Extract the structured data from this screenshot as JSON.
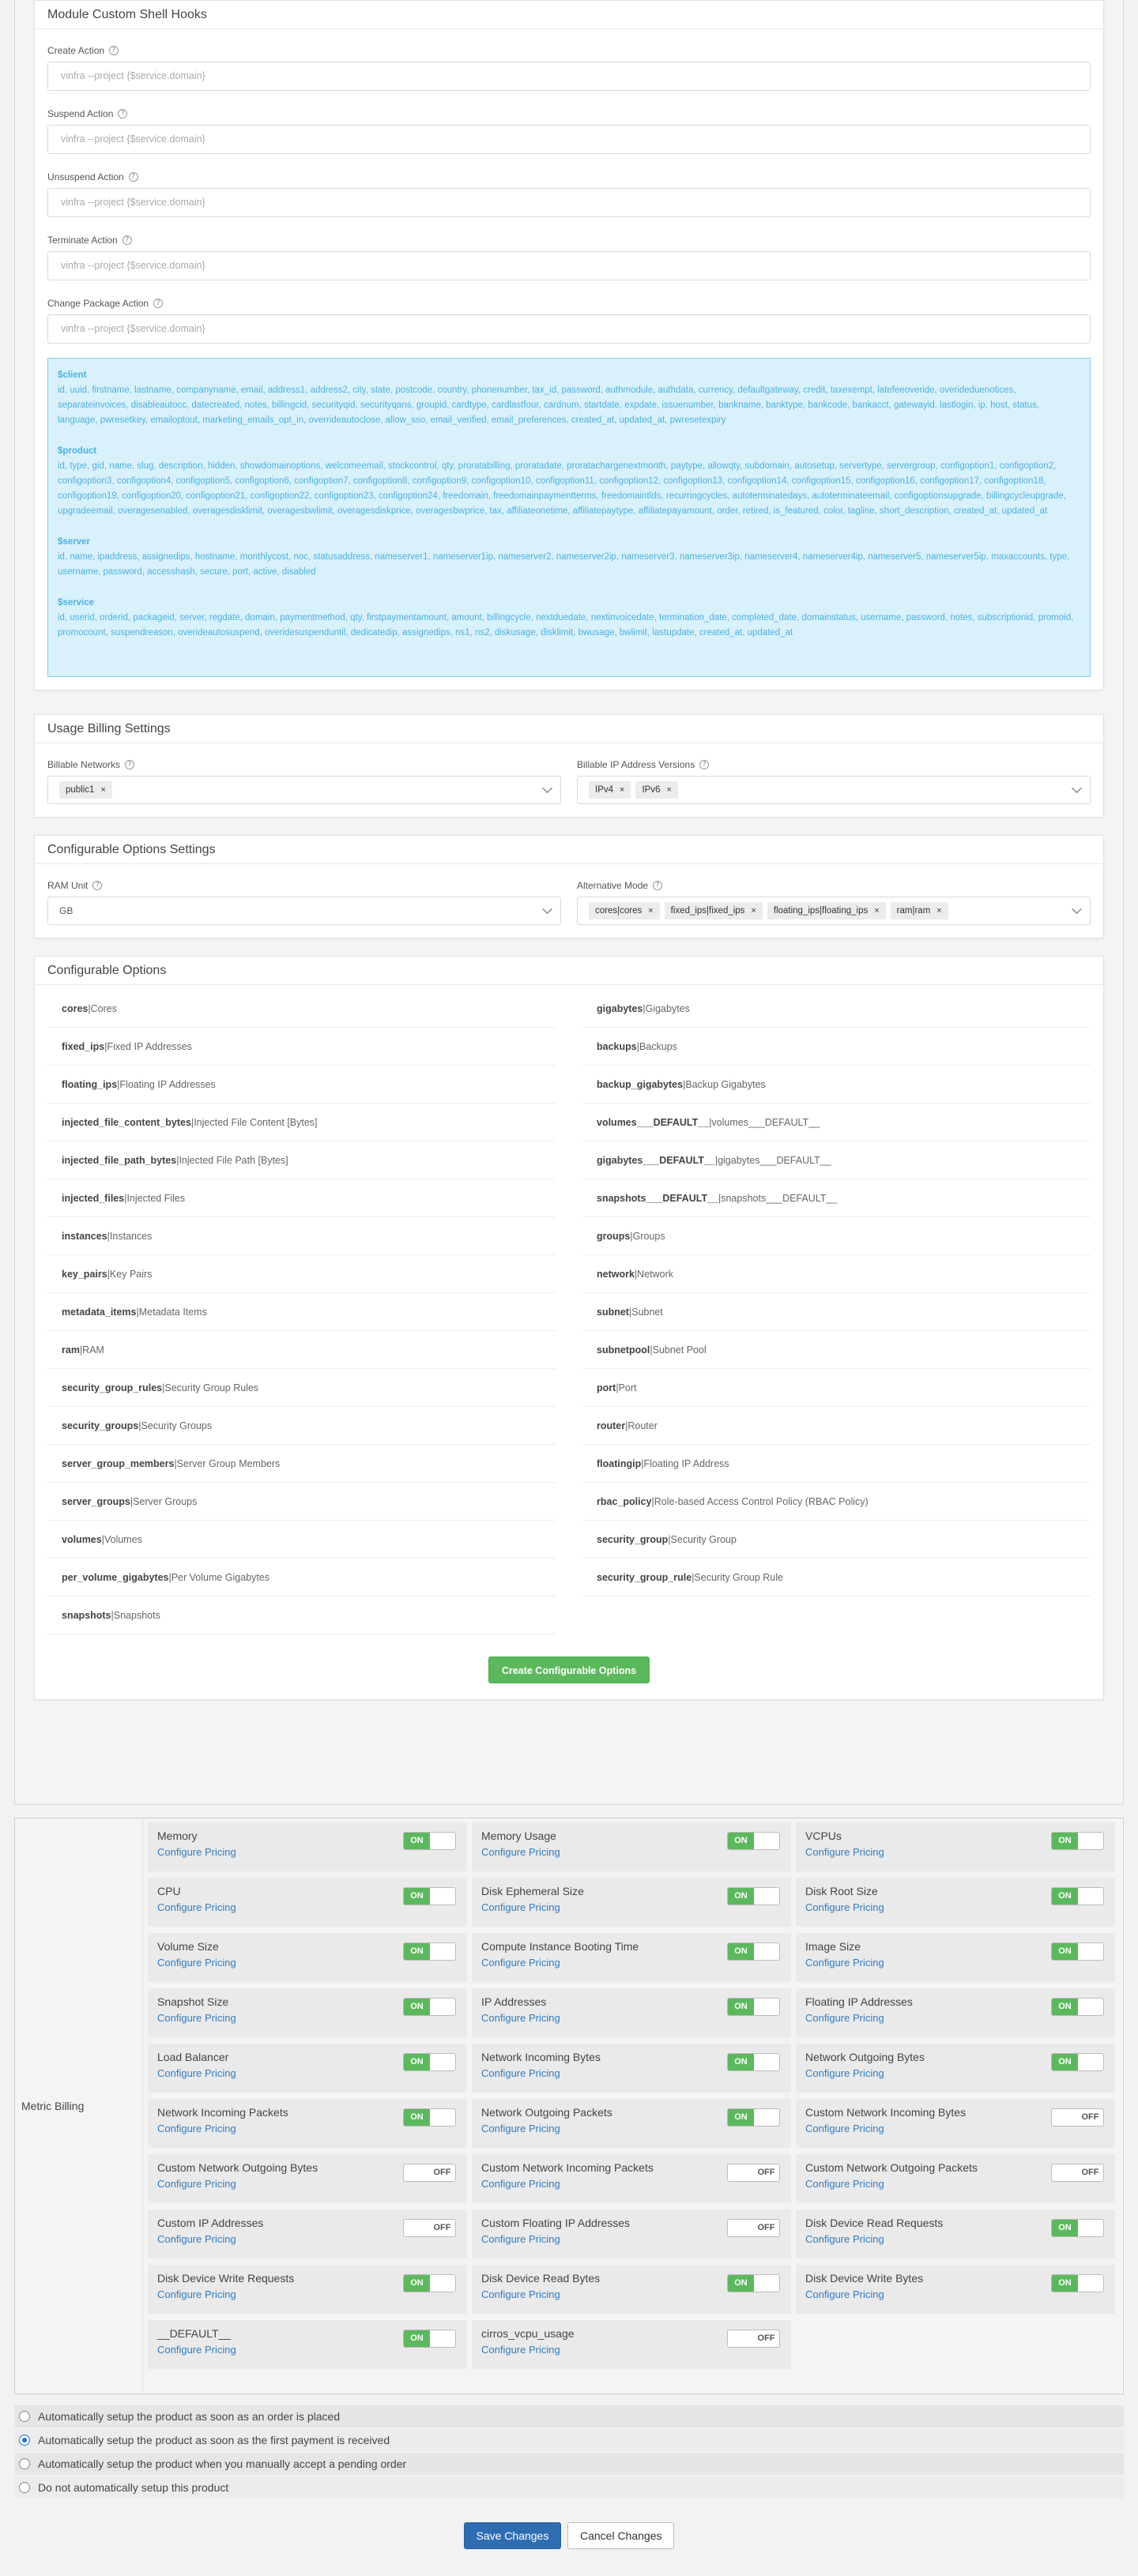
{
  "shell": {
    "title": "Module Custom Shell Hooks",
    "fields": [
      {
        "label": "Create Action",
        "placeholder": "vinfra --project {$service.domain}"
      },
      {
        "label": "Suspend Action",
        "placeholder": "vinfra --project {$service.domain}"
      },
      {
        "label": "Unsuspend Action",
        "placeholder": "vinfra --project {$service.domain}"
      },
      {
        "label": "Terminate Action",
        "placeholder": "vinfra --project {$service.domain}"
      },
      {
        "label": "Change Package Action",
        "placeholder": "vinfra --project {$service.domain}"
      }
    ],
    "variables": [
      {
        "title": "$client",
        "text": "id, uuid, firstname, lastname, companyname, email, address1, address2, city, state, postcode, country, phonenumber, tax_id, password, authmodule, authdata, currency, defaultgateway, credit, taxexempt, latefeeoveride, overideduenotices, separateinvoices, disableautocc, datecreated, notes, billingcid, securityqid, securityqans, groupid, cardtype, cardlastfour, cardnum, startdate, expdate, issuenumber, bankname, banktype, bankcode, bankacct, gatewayid, lastlogin, ip, host, status, language, pwresetkey, emailoptout, marketing_emails_opt_in, overrideautoclose, allow_sso, email_verified, email_preferences, created_at, updated_at, pwresetexpiry"
      },
      {
        "title": "$product",
        "text": "id, type, gid, name, slug, description, hidden, showdomainoptions, welcomeemail, stockcontrol, qty, proratabilling, proratadate, proratachargenextmonth, paytype, allowqty, subdomain, autosetup, servertype, servergroup, configoption1, configoption2, configoption3, configoption4, configoption5, configoption6, configoption7, configoption8, configoption9, configoption10, configoption11, configoption12, configoption13, configoption14, configoption15, configoption16, configoption17, configoption18, configoption19, configoption20, configoption21, configoption22, configoption23, configoption24, freedomain, freedomainpaymentterms, freedomaintlds, recurringcycles, autoterminatedays, autoterminateemail, configoptionsupgrade, billingcycleupgrade, upgradeemail, overagesenabled, overagesdisklimit, overagesbwlimit, overagesdiskprice, overagesbwprice, tax, affiliateonetime, affiliatepaytype, affiliatepayamount, order, retired, is_featured, color, tagline, short_description, created_at, updated_at"
      },
      {
        "title": "$server",
        "text": "id, name, ipaddress, assignedips, hostname, monthlycost, noc, statusaddress, nameserver1, nameserver1ip, nameserver2, nameserver2ip, nameserver3, nameserver3ip, nameserver4, nameserver4ip, nameserver5, nameserver5ip, maxaccounts, type, username, password, accesshash, secure, port, active, disabled"
      },
      {
        "title": "$service",
        "text": "id, userid, orderid, packageid, server, regdate, domain, paymentmethod, qty, firstpaymentamount, amount, billingcycle, nextduedate, nextinvoicedate, termination_date, completed_date, domainstatus, username, password, notes, subscriptionid, promoid, promocount, suspendreason, overideautosuspend, overidesuspenduntil, dedicatedip, assignedips, ns1, ns2, diskusage, disklimit, bwusage, bwlimit, lastupdate, created_at, updated_at"
      }
    ]
  },
  "usage": {
    "title": "Usage Billing Settings",
    "networks_label": "Billable Networks",
    "networks": [
      "public1"
    ],
    "ipver_label": "Billable IP Address Versions",
    "ipver": [
      "IPv4",
      "IPv6"
    ]
  },
  "cos": {
    "title": "Configurable Options Settings",
    "ram_label": "RAM Unit",
    "ram_value": "GB",
    "alt_label": "Alternative Mode",
    "alt": [
      "cores|cores",
      "fixed_ips|fixed_ips",
      "floating_ips|floating_ips",
      "ram|ram"
    ]
  },
  "co": {
    "title": "Configurable Options",
    "items": [
      {
        "k": "cores",
        "v": "|Cores"
      },
      {
        "k": "gigabytes",
        "v": "|Gigabytes"
      },
      {
        "k": "fixed_ips",
        "v": "|Fixed IP Addresses"
      },
      {
        "k": "backups",
        "v": "|Backups"
      },
      {
        "k": "floating_ips",
        "v": "|Floating IP Addresses"
      },
      {
        "k": "backup_gigabytes",
        "v": "|Backup Gigabytes"
      },
      {
        "k": "injected_file_content_bytes",
        "v": "|Injected File Content [Bytes]"
      },
      {
        "k": "volumes___DEFAULT__",
        "v": "|volumes___DEFAULT__"
      },
      {
        "k": "injected_file_path_bytes",
        "v": "|Injected File Path [Bytes]"
      },
      {
        "k": "gigabytes___DEFAULT__",
        "v": "|gigabytes___DEFAULT__"
      },
      {
        "k": "injected_files",
        "v": "|Injected Files"
      },
      {
        "k": "snapshots___DEFAULT__",
        "v": "|snapshots___DEFAULT__"
      },
      {
        "k": "instances",
        "v": "|Instances"
      },
      {
        "k": "groups",
        "v": "|Groups"
      },
      {
        "k": "key_pairs",
        "v": "|Key Pairs"
      },
      {
        "k": "network",
        "v": "|Network"
      },
      {
        "k": "metadata_items",
        "v": "|Metadata Items"
      },
      {
        "k": "subnet",
        "v": "|Subnet"
      },
      {
        "k": "ram",
        "v": "|RAM"
      },
      {
        "k": "subnetpool",
        "v": "|Subnet Pool"
      },
      {
        "k": "security_group_rules",
        "v": "|Security Group Rules"
      },
      {
        "k": "port",
        "v": "|Port"
      },
      {
        "k": "security_groups",
        "v": "|Security Groups"
      },
      {
        "k": "router",
        "v": "|Router"
      },
      {
        "k": "server_group_members",
        "v": "|Server Group Members"
      },
      {
        "k": "floatingip",
        "v": "|Floating IP Address"
      },
      {
        "k": "server_groups",
        "v": "|Server Groups"
      },
      {
        "k": "rbac_policy",
        "v": "|Role-based Access Control Policy (RBAC Policy)"
      },
      {
        "k": "volumes",
        "v": "|Volumes"
      },
      {
        "k": "security_group",
        "v": "|Security Group"
      },
      {
        "k": "per_volume_gigabytes",
        "v": "|Per Volume Gigabytes"
      },
      {
        "k": "security_group_rule",
        "v": "|Security Group Rule"
      },
      {
        "k": "snapshots",
        "v": "|Snapshots"
      }
    ],
    "create_btn": "Create Configurable Options"
  },
  "metric": {
    "label": "Metric Billing",
    "configure": "Configure Pricing",
    "on_text": "ON",
    "off_text": "OFF",
    "items": [
      {
        "name": "Memory",
        "on": true
      },
      {
        "name": "Memory Usage",
        "on": true
      },
      {
        "name": "VCPUs",
        "on": true
      },
      {
        "name": "CPU",
        "on": true
      },
      {
        "name": "Disk Ephemeral Size",
        "on": true
      },
      {
        "name": "Disk Root Size",
        "on": true
      },
      {
        "name": "Volume Size",
        "on": true
      },
      {
        "name": "Compute Instance Booting Time",
        "on": true
      },
      {
        "name": "Image Size",
        "on": true
      },
      {
        "name": "Snapshot Size",
        "on": true
      },
      {
        "name": "IP Addresses",
        "on": true
      },
      {
        "name": "Floating IP Addresses",
        "on": true
      },
      {
        "name": "Load Balancer",
        "on": true
      },
      {
        "name": "Network Incoming Bytes",
        "on": true
      },
      {
        "name": "Network Outgoing Bytes",
        "on": true
      },
      {
        "name": "Network Incoming Packets",
        "on": true
      },
      {
        "name": "Network Outgoing Packets",
        "on": true
      },
      {
        "name": "Custom Network Incoming Bytes",
        "on": false
      },
      {
        "name": "Custom Network Outgoing Bytes",
        "on": false
      },
      {
        "name": "Custom Network Incoming Packets",
        "on": false
      },
      {
        "name": "Custom Network Outgoing Packets",
        "on": false
      },
      {
        "name": "Custom IP Addresses",
        "on": false
      },
      {
        "name": "Custom Floating IP Addresses",
        "on": false
      },
      {
        "name": "Disk Device Read Requests",
        "on": true
      },
      {
        "name": "Disk Device Write Requests",
        "on": true
      },
      {
        "name": "Disk Device Read Bytes",
        "on": true
      },
      {
        "name": "Disk Device Write Bytes",
        "on": true
      },
      {
        "name": "__DEFAULT__",
        "on": true
      },
      {
        "name": "cirros_vcpu_usage",
        "on": false
      }
    ]
  },
  "autosetup": {
    "options": [
      {
        "label": "Automatically setup the product as soon as an order is placed",
        "checked": false
      },
      {
        "label": "Automatically setup the product as soon as the first payment is received",
        "checked": true
      },
      {
        "label": "Automatically setup the product when you manually accept a pending order",
        "checked": false
      },
      {
        "label": "Do not automatically setup this product",
        "checked": false
      }
    ]
  },
  "actions": {
    "save": "Save Changes",
    "cancel": "Cancel Changes"
  }
}
